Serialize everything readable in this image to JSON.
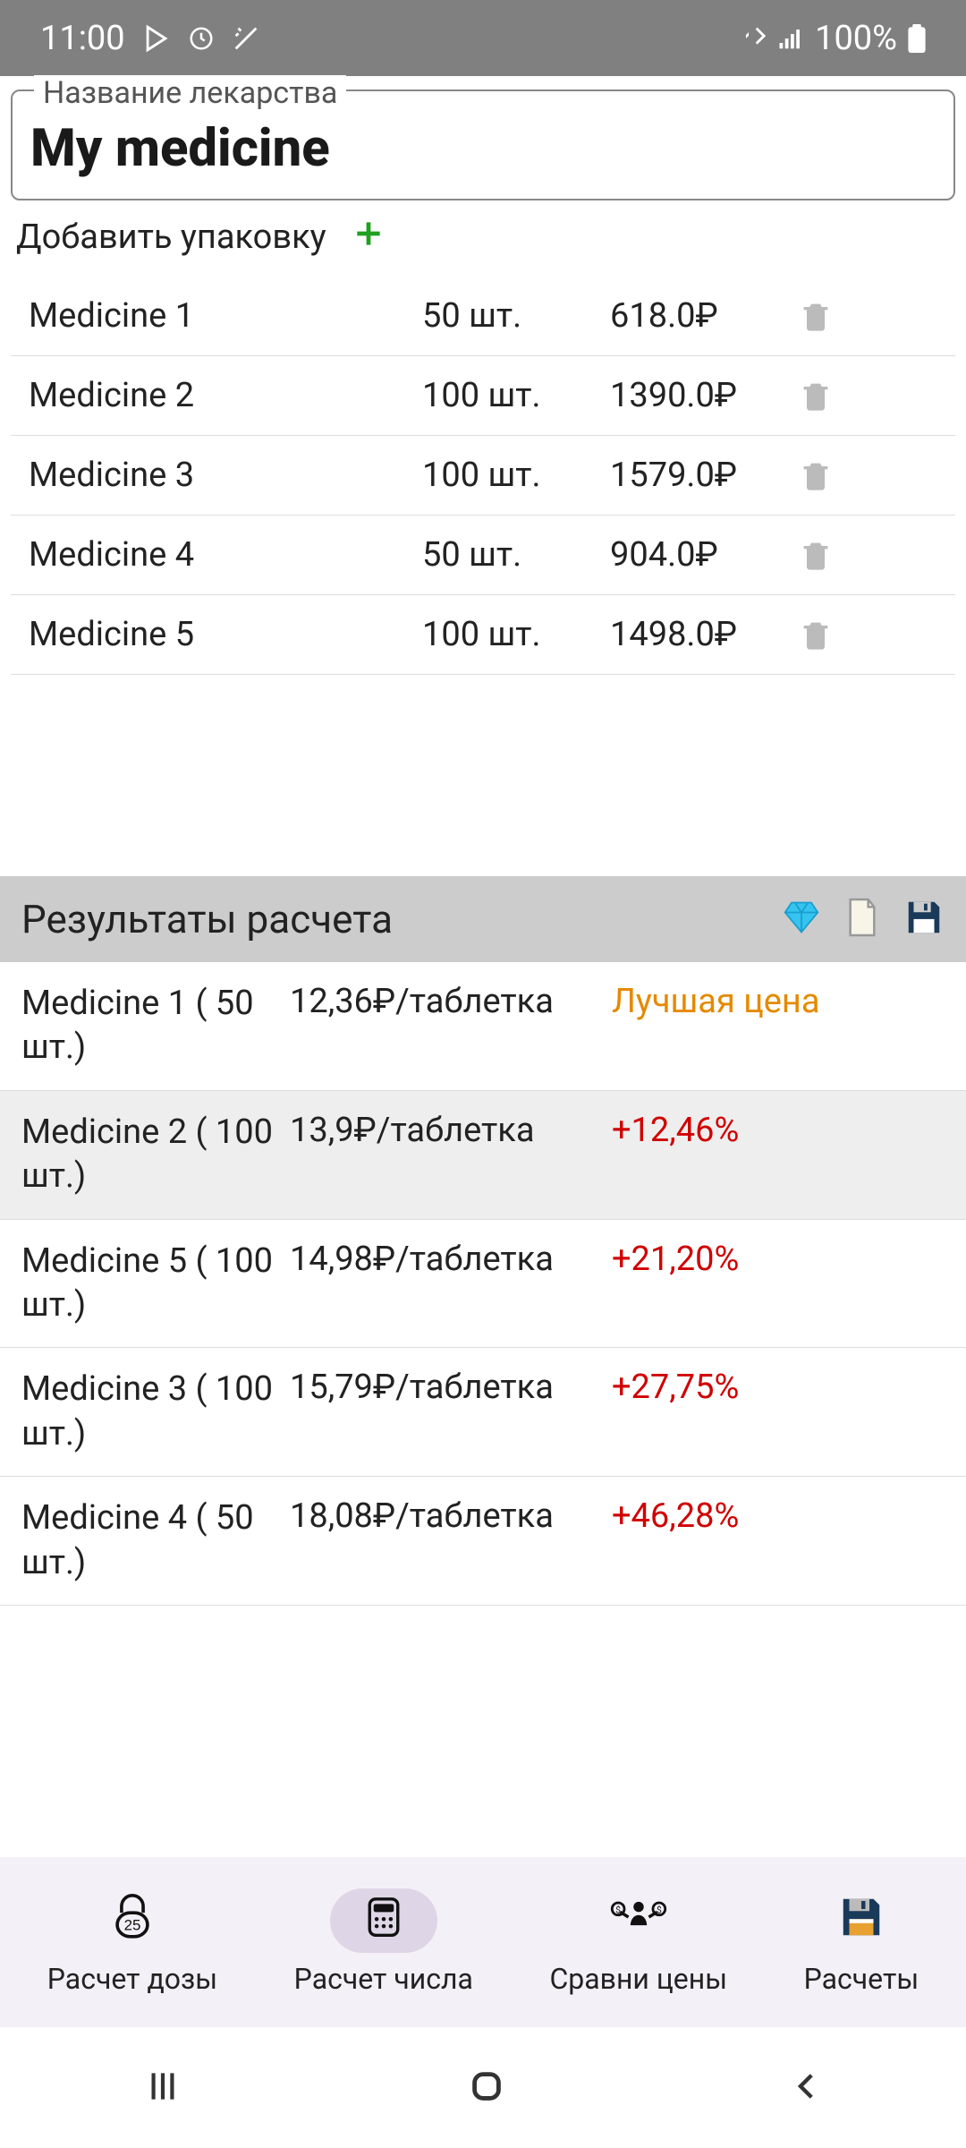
{
  "status_bar": {
    "time": "11:00",
    "battery": "100%"
  },
  "medicine_name": {
    "label": "Название лекарства",
    "value": "My medicine"
  },
  "add_package": {
    "label": "Добавить упаковку"
  },
  "packages": [
    {
      "name": "Medicine 1",
      "qty": "50 шт.",
      "price": "618.0₽"
    },
    {
      "name": "Medicine 2",
      "qty": "100 шт.",
      "price": "1390.0₽"
    },
    {
      "name": "Medicine 3",
      "qty": "100 шт.",
      "price": "1579.0₽"
    },
    {
      "name": "Medicine 4",
      "qty": "50 шт.",
      "price": "904.0₽"
    },
    {
      "name": "Medicine 5",
      "qty": "100 шт.",
      "price": "1498.0₽"
    }
  ],
  "results": {
    "title": "Результаты расчета",
    "rows": [
      {
        "name": "Medicine 1 ( 50 шт.)",
        "price": "12,36₽/таблетка",
        "diff": "Лучшая цена",
        "best": true,
        "alt": false
      },
      {
        "name": "Medicine 2 ( 100 шт.)",
        "price": "13,9₽/таблетка",
        "diff": "+12,46%",
        "best": false,
        "alt": true
      },
      {
        "name": "Medicine 5 ( 100 шт.)",
        "price": "14,98₽/таблетка",
        "diff": "+21,20%",
        "best": false,
        "alt": false
      },
      {
        "name": "Medicine 3 ( 100 шт.)",
        "price": "15,79₽/таблетка",
        "diff": "+27,75%",
        "best": false,
        "alt": false
      },
      {
        "name": "Medicine 4 ( 50 шт.)",
        "price": "18,08₽/таблетка",
        "diff": "+46,28%",
        "best": false,
        "alt": false
      }
    ]
  },
  "bottom_nav": {
    "items": [
      {
        "label": "Расчет дозы",
        "icon": "lock25-icon"
      },
      {
        "label": "Расчет числа",
        "icon": "calculator-icon",
        "active": true
      },
      {
        "label": "Сравни цены",
        "icon": "compare-money-icon"
      },
      {
        "label": "Расчеты",
        "icon": "floppy-icon"
      }
    ]
  }
}
